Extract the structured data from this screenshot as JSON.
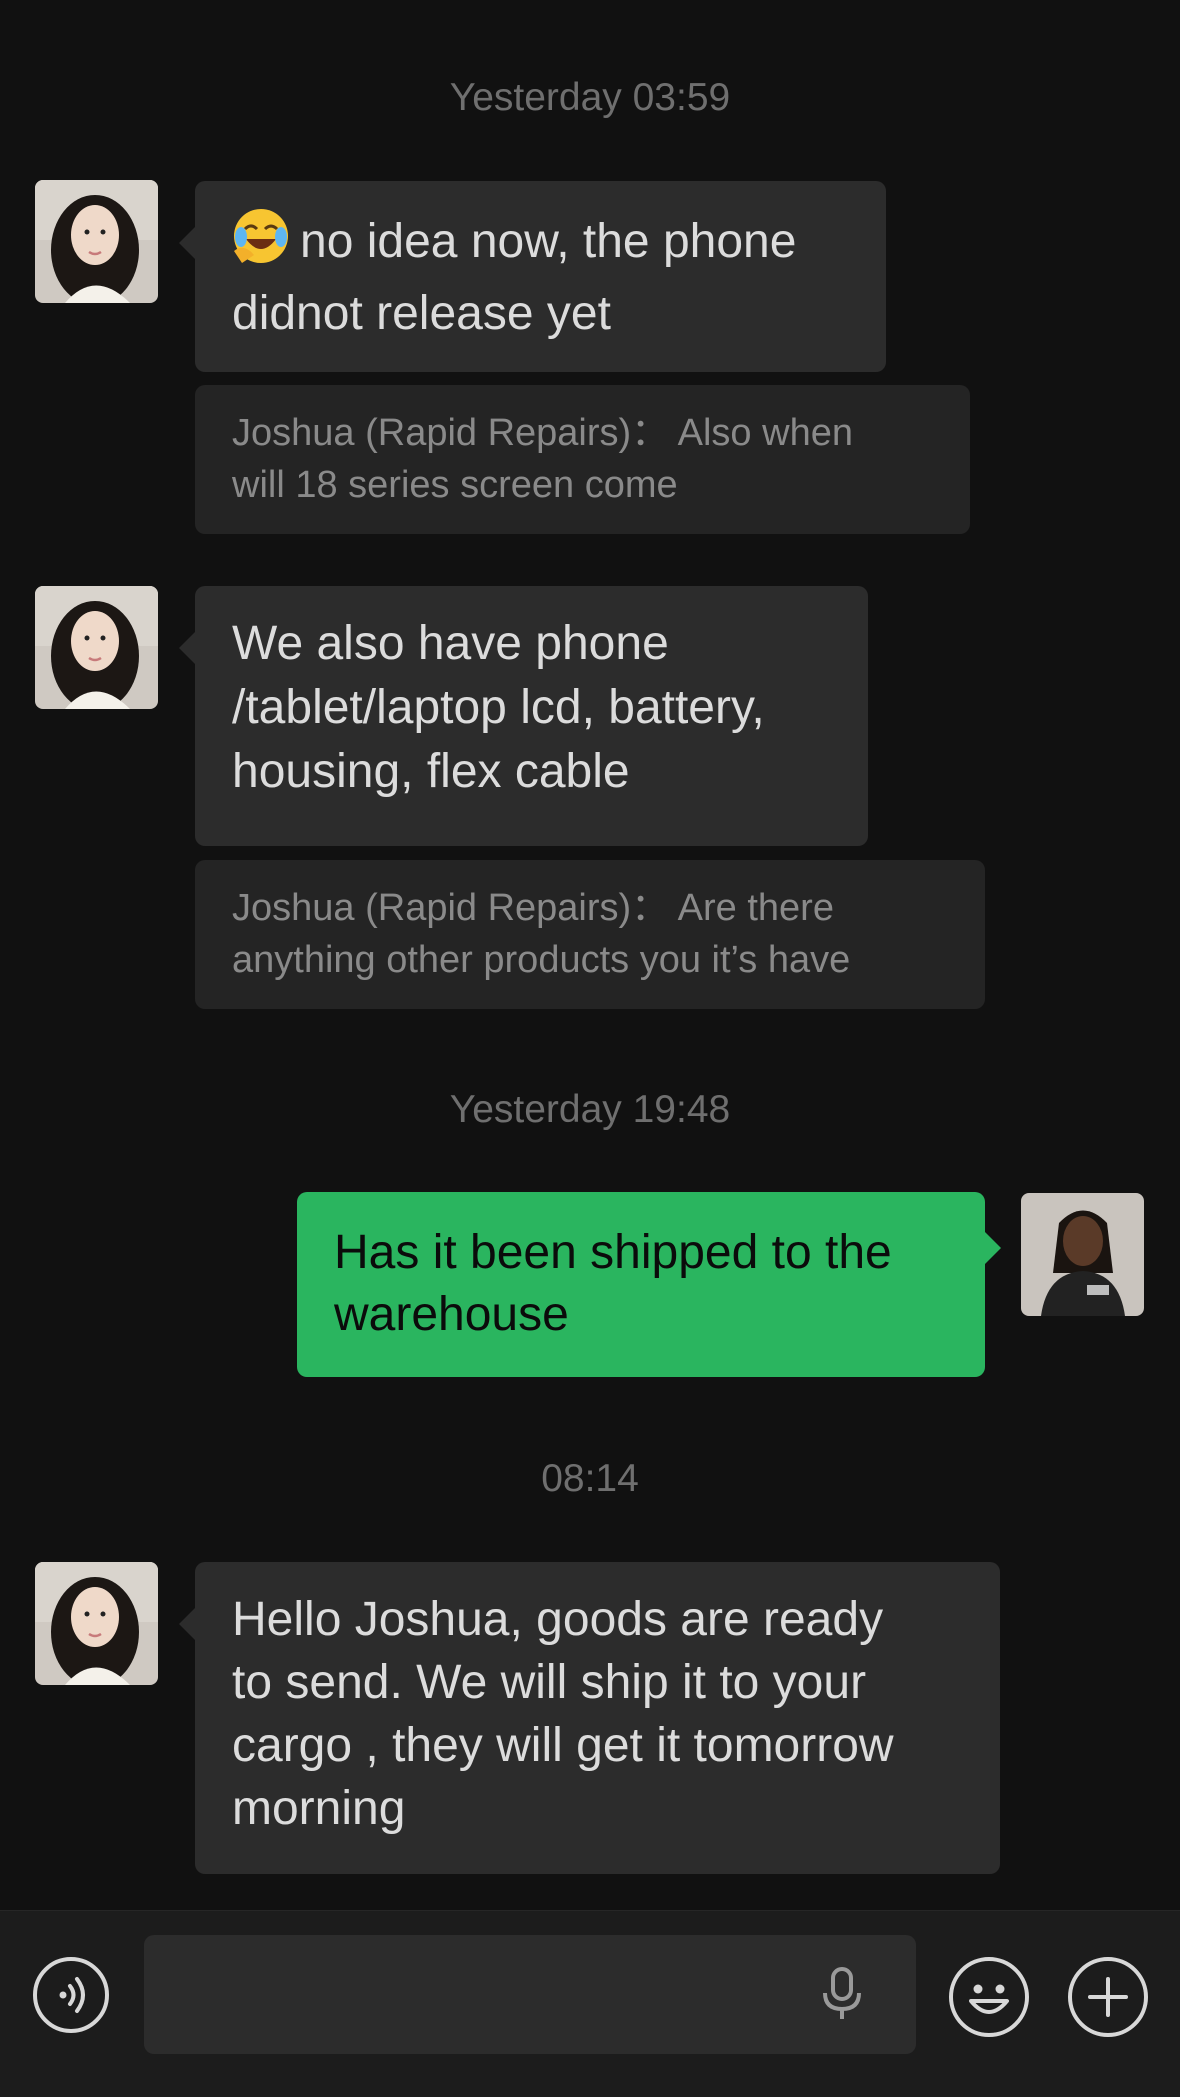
{
  "messages": {
    "ts1": "Yesterday 03:59",
    "m1_line1": "no idea now, the phone",
    "m1_line2": "didnot release yet",
    "q1_line1": "Joshua (Rapid Repairs)：  Also when",
    "q1_line2": "will 18 series screen come",
    "m2_line1": "We also have phone",
    "m2_line2": "/tablet/laptop lcd, battery,",
    "m2_line3": "housing, flex cable",
    "q2_line1": "Joshua (Rapid Repairs)：  Are there",
    "q2_line2": "anything other products you it’s have",
    "ts2": "Yesterday 19:48",
    "m3_line1": "Has it been shipped to the",
    "m3_line2": "warehouse",
    "ts3": "08:14",
    "m4_line1": "Hello Joshua, goods are ready",
    "m4_line2": "to send. We will ship it to your",
    "m4_line3": "cargo , they will get it tomorrow",
    "m4_line4": "morning"
  },
  "input": {
    "value": ""
  },
  "icons": {
    "voice": "voice-icon",
    "mic": "microphone-icon",
    "emoji": "emoji-icon",
    "plus": "plus-icon",
    "laugh_emoji": "laughing-crying-emoji"
  },
  "colors": {
    "background": "#111111",
    "incoming_bubble": "#2c2c2c",
    "outgoing_bubble": "#2ab55f",
    "quote_bg": "#242424",
    "timestamp": "#6f6f6f"
  }
}
